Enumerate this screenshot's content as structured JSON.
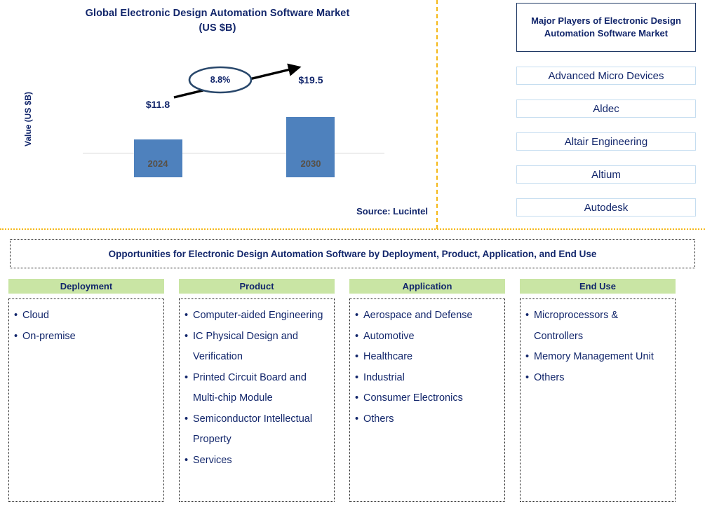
{
  "chart_panel": {
    "title": "Global Electronic Design Automation Software Market\n(US $B)",
    "title_line1": "Global Electronic Design Automation Software Market",
    "title_line2": "(US $B)",
    "source": "Source: Lucintel"
  },
  "chart_data": {
    "type": "bar",
    "title": "Global Electronic Design Automation Software Market (US $B)",
    "xlabel": "",
    "ylabel": "Value (US $B)",
    "categories": [
      "2024",
      "2030"
    ],
    "values": [
      11.8,
      19.5
    ],
    "value_labels": [
      "$11.8",
      "$19.5"
    ],
    "ylim": [
      0,
      22
    ],
    "grid": false,
    "legend": "none",
    "bar_color": "#4e81bd",
    "annotations": [
      {
        "type": "cagr-arrow",
        "label": "8.8%",
        "from_category": "2024",
        "to_category": "2030"
      }
    ]
  },
  "players": {
    "title": "Major Players of Electronic Design Automation Software Market",
    "items": [
      "Advanced Micro Devices",
      "Aldec",
      "Altair Engineering",
      "Altium",
      "Autodesk"
    ]
  },
  "opportunities": {
    "header": "Opportunities for Electronic Design Automation Software by Deployment, Product, Application, and End Use",
    "columns": [
      {
        "title": "Deployment",
        "items": [
          "Cloud",
          "On-premise"
        ]
      },
      {
        "title": "Product",
        "items": [
          "Computer-aided Engineering",
          "IC Physical Design and Verification",
          "Printed Circuit Board and Multi-chip Module",
          "Semiconductor Intellectual Property",
          "Services"
        ]
      },
      {
        "title": "Application",
        "items": [
          "Aerospace and Defense",
          "Automotive",
          "Healthcare",
          "Industrial",
          "Consumer Electronics",
          "Others"
        ]
      },
      {
        "title": "End Use",
        "items": [
          "Microprocessors & Controllers",
          "Memory Management Unit",
          "Others"
        ]
      }
    ]
  },
  "colors": {
    "navy": "#12266b",
    "bar_blue": "#4e81bd",
    "green_header": "#c9e5a4",
    "divider_gold": "#f5b817",
    "player_border": "#c5ddf0"
  }
}
